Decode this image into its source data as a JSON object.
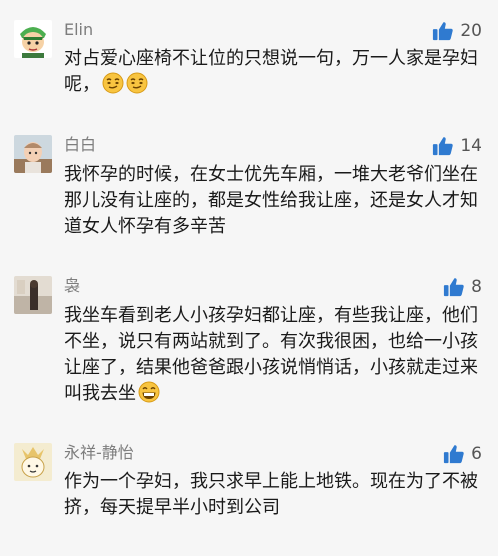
{
  "comments": [
    {
      "username": "Elin",
      "likes": "20",
      "text": "对占爱心座椅不让位的只想说一句，万一人家是孕妇呢，",
      "avatar": "zoro-avatar",
      "emoji": [
        "smirk-emoji",
        "smirk-emoji"
      ]
    },
    {
      "username": "白白",
      "likes": "14",
      "text": "我怀孕的时候，在女士优先车厢，一堆大老爷们坐在那儿没有让座的，都是女性给我让座，还是女人才知道女人怀孕有多辛苦",
      "avatar": "baby-avatar",
      "emoji": []
    },
    {
      "username": "袅",
      "likes": "8",
      "text": "我坐车看到老人小孩孕妇都让座，有些我让座，他们不坐，说只有两站就到了。有次我很困，也给一小孩让座了，结果他爸爸跟小孩说悄悄话，小孩就走过来叫我去坐",
      "avatar": "photo-avatar",
      "emoji": [
        "grin-emoji"
      ]
    },
    {
      "username": "永祥-静怡",
      "likes": "6",
      "text": "作为一个孕妇，我只求早上能上地铁。现在为了不被挤，每天提早半小时到公司",
      "avatar": "cartoon-avatar",
      "emoji": []
    }
  ],
  "colors": {
    "background": "#f6f6f6",
    "like_icon": "#2f7ad0",
    "username": "#7d7d7d",
    "text": "#1a1a1a",
    "emoji_face": "#f8c440"
  }
}
